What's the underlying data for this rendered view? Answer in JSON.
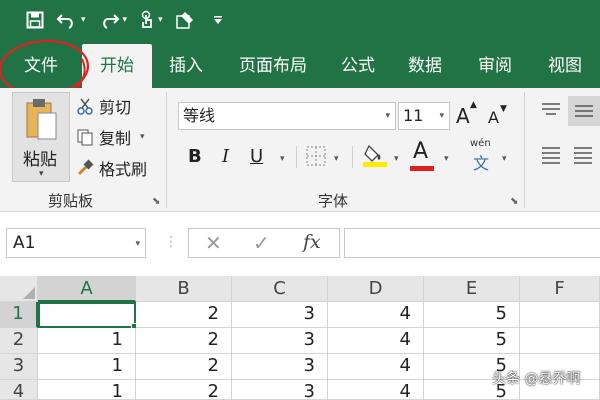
{
  "qat": {
    "icons": [
      "save-icon",
      "undo-icon",
      "redo-icon",
      "touch-mode-icon",
      "form-icon",
      "customize-icon"
    ]
  },
  "tabs": [
    "文件",
    "开始",
    "插入",
    "页面布局",
    "公式",
    "数据",
    "审阅",
    "视图"
  ],
  "active_tab": "开始",
  "annotation_color": "#e0211f",
  "ribbon": {
    "clipboard": {
      "paste": "粘贴",
      "cut": "剪切",
      "copy": "复制",
      "format_painter": "格式刷",
      "group_label": "剪贴板"
    },
    "font": {
      "font_name": "等线",
      "font_size": "11",
      "grow": "A",
      "shrink": "A",
      "bold": "B",
      "italic": "I",
      "underline": "U",
      "font_color_letter": "A",
      "phonetic_top": "wén",
      "phonetic_bottom": "文",
      "group_label": "字体",
      "highlight_color": "#ffeb00",
      "font_color": "#e02020"
    }
  },
  "formula_bar": {
    "name_box": "A1",
    "fx": "fx",
    "value": ""
  },
  "sheet": {
    "columns": [
      "A",
      "B",
      "C",
      "D",
      "E",
      "F"
    ],
    "rows": [
      {
        "num": "1",
        "cells": [
          "",
          "2",
          "3",
          "4",
          "5",
          ""
        ]
      },
      {
        "num": "2",
        "cells": [
          "1",
          "2",
          "3",
          "4",
          "5",
          ""
        ]
      },
      {
        "num": "3",
        "cells": [
          "1",
          "2",
          "3",
          "4",
          "5",
          ""
        ]
      },
      {
        "num": "4",
        "cells": [
          "1",
          "2",
          "3",
          "4",
          "5",
          ""
        ]
      }
    ],
    "selected_cell": "A1",
    "accent": "#217346"
  },
  "watermark": "头条 @悬乔啊"
}
